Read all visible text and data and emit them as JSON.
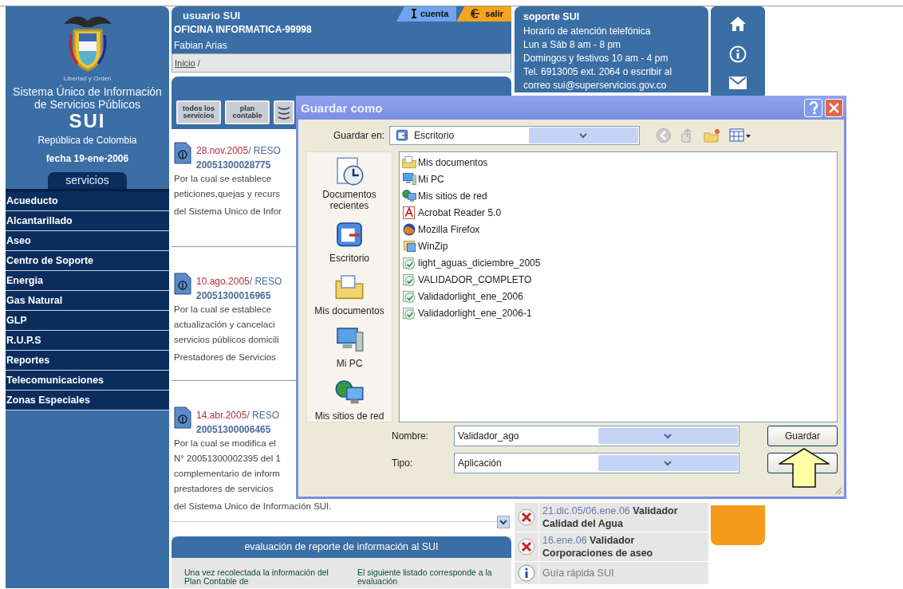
{
  "sidebar": {
    "motto": "Libertad y Orden",
    "system_name": "Sistema Único de Información de Servicios Públicos",
    "acronym": "SUI",
    "country": "República de Colombia",
    "date": "fecha 19-ene-2006",
    "menu_tab": "servicios",
    "items": [
      "Acueducto",
      "Alcantarillado",
      "Aseo",
      "Centro de Soporte",
      "Energia",
      "Gas Natural",
      "GLP",
      "R.U.P.S",
      "Reportes",
      "Telecomunicaciones",
      "Zonas Especiales"
    ]
  },
  "user_panel": {
    "title": "usuario SUI",
    "tabs": [
      {
        "label": "cuenta",
        "kind": "account",
        "color": "#6fa3ec"
      },
      {
        "label": "salir",
        "kind": "exit",
        "color": "#f5a41e"
      }
    ],
    "office": "OFICINA INFORMATICA-99998",
    "user": "Fabian Arias",
    "breadcrumb": {
      "link": "Inicio",
      "separator": "/"
    }
  },
  "news_panel": {
    "buttons": [
      {
        "kind": "text",
        "label": "todos los servicios"
      },
      {
        "kind": "text",
        "label": "plan contable"
      },
      {
        "kind": "icon"
      }
    ],
    "items": [
      {
        "date": "28.nov.2005",
        "separator": "/",
        "type": "RESO",
        "number": "20051300028775",
        "lines": [
          "Por la cual se establece",
          "peticiones,quejas y recurs",
          "del Sistema Unico de Infor"
        ]
      },
      {
        "date": "10.ago.2005",
        "separator": "/",
        "type": "RESO",
        "number": "20051300016965",
        "lines": [
          "Por la cual se establece",
          "actualización y cancelaci",
          "servicios públicos domicili",
          "Prestadores de Servicios"
        ]
      },
      {
        "date": "14.abr.2005",
        "separator": "/",
        "type": "RESO",
        "number": "20051300006465",
        "lines": [
          "Por la cual se modifica el",
          "N° 20051300002395 del 1",
          "complementario de inform",
          "prestadores de servicios",
          "del Sistema Unico de Información SUI."
        ]
      }
    ]
  },
  "evaluation_panel": {
    "title": "evaluación de reporte de información al SUI",
    "columns": [
      "Una vez recolectada la información del Plan Contable de",
      "El siguiente listado corresponde a la evaluación"
    ]
  },
  "support_panel": {
    "title": "soporte SUI",
    "lines": [
      "Horario de atención telefónica",
      "Lun a Sáb 8 am - 8 pm",
      "Domingos y festivos 10 am - 4 pm",
      "Tel. 6913005 ext. 2064 o escribir al",
      "correo sui@superservicios.gov.co"
    ]
  },
  "notices": [
    {
      "kind": "validator",
      "date": "21.dic.05/06.ene.06",
      "title": "Validador Calidad del Agua"
    },
    {
      "kind": "validator",
      "date": "16.ene.06",
      "title": "Validador Corporaciones de aseo"
    },
    {
      "kind": "guide",
      "title": "Guía rápida SUI"
    }
  ],
  "dialog": {
    "title": "Guardar como",
    "location_label": "Guardar en:",
    "location": "Escritorio",
    "places": [
      {
        "kind": "recent",
        "label": "Documentos recientes"
      },
      {
        "kind": "desktop",
        "label": "Escritorio"
      },
      {
        "kind": "documents",
        "label": "Mis documentos"
      },
      {
        "kind": "computer",
        "label": "Mi PC"
      },
      {
        "kind": "network",
        "label": "Mis sitios de red"
      }
    ],
    "files": [
      {
        "kind": "documents",
        "name": "Mis documentos"
      },
      {
        "kind": "computer",
        "name": "Mi PC"
      },
      {
        "kind": "network",
        "name": "Mis sitios de red"
      },
      {
        "kind": "acrobat",
        "name": "Acrobat Reader 5.0"
      },
      {
        "kind": "browser",
        "name": "Mozilla Firefox"
      },
      {
        "kind": "zip",
        "name": "WinZip"
      },
      {
        "kind": "app",
        "name": "light_aguas_diciembre_2005"
      },
      {
        "kind": "app",
        "name": "VALIDADOR_COMPLETO"
      },
      {
        "kind": "app",
        "name": "Validadorlight_ene_2006"
      },
      {
        "kind": "app",
        "name": "Validadorlight_ene_2006-1"
      }
    ],
    "name_label": "Nombre:",
    "name_value": "Validador_ago",
    "type_label": "Tipo:",
    "type_value": "Aplicación",
    "save_button": "Guardar"
  }
}
